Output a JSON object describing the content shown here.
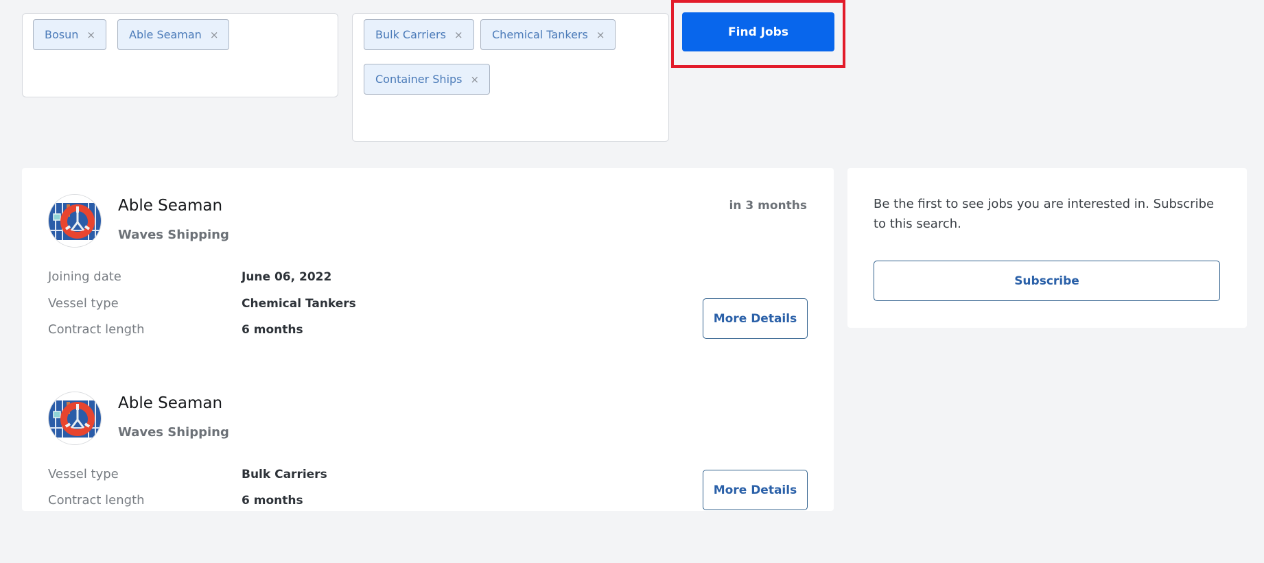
{
  "filters": {
    "roles": [
      {
        "label": "Bosun",
        "remove_icon": "×"
      },
      {
        "label": "Able Seaman",
        "remove_icon": "×"
      }
    ],
    "vessel_types": [
      {
        "label": "Bulk Carriers",
        "remove_icon": "×"
      },
      {
        "label": "Chemical Tankers",
        "remove_icon": "×"
      },
      {
        "label": "Container Ships",
        "remove_icon": "×"
      }
    ],
    "find_jobs_label": "Find Jobs"
  },
  "highlight": {
    "color": "#e21b2a",
    "target": "find-jobs-button"
  },
  "jobs": [
    {
      "title": "Able Seaman",
      "company": "Waves Shipping",
      "when": "in 3 months",
      "avatar_icon": "lifebuoy-image",
      "details": [
        {
          "label": "Joining date",
          "value": "June 06, 2022"
        },
        {
          "label": "Vessel type",
          "value": "Chemical Tankers"
        },
        {
          "label": "Contract length",
          "value": "6 months"
        }
      ],
      "more_details_label": "More Details"
    },
    {
      "title": "Able Seaman",
      "company": "Waves Shipping",
      "when": "",
      "avatar_icon": "lifebuoy-image",
      "details": [
        {
          "label": "Vessel type",
          "value": "Bulk Carriers"
        },
        {
          "label": "Contract length",
          "value": "6 months"
        }
      ],
      "more_details_label": "More Details"
    }
  ],
  "subscribe": {
    "text": "Be the first to see jobs you are interested in. Subscribe to this search.",
    "button_label": "Subscribe"
  },
  "colors": {
    "primary": "#0866ec",
    "chip_bg": "#e8f1fc",
    "chip_text": "#4a7ab8",
    "outline_button": "#2f5f8c",
    "page_bg": "#f3f4f6"
  }
}
